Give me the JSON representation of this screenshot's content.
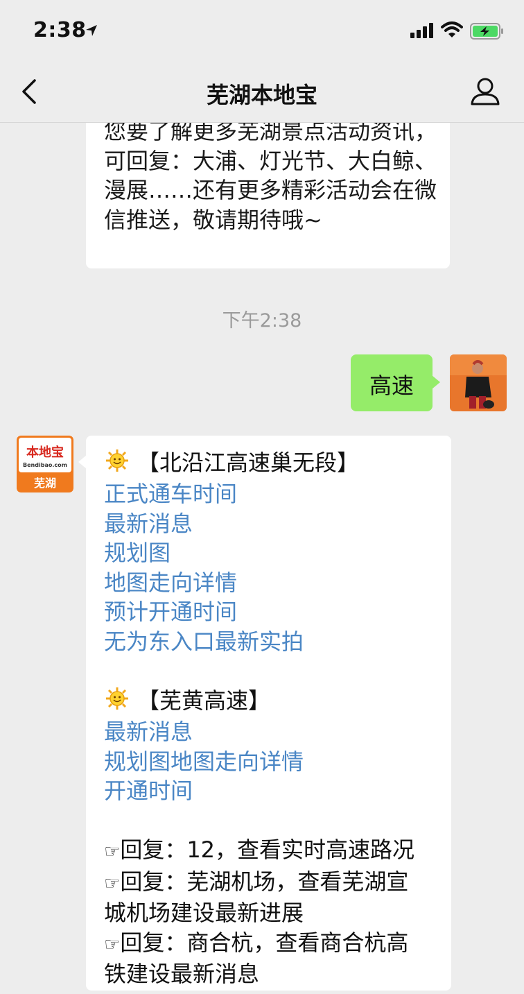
{
  "status_bar": {
    "time": "2:38"
  },
  "nav": {
    "title": "芜湖本地宝"
  },
  "top_message": {
    "text": "您要了解更多芜湖景点活动资讯，可回复：大浦、灯光节、大白鲸、漫展……还有更多精彩活动会在微信推送，敬请期待哦~"
  },
  "timestamp": "下午2:38",
  "user_message": {
    "text": "高速"
  },
  "bot_avatar": {
    "brand": "本地宝",
    "domain": "Bendibao.com",
    "city": "芜湖"
  },
  "bot_reply": {
    "section1": {
      "heading": "【北沿江高速巢无段】",
      "links": [
        "正式通车时间",
        "最新消息",
        "规划图",
        "地图走向详情",
        "预计开通时间",
        "无为东入口最新实拍"
      ]
    },
    "section2": {
      "heading": "【芜黄高速】",
      "links": [
        "最新消息",
        "规划图地图走向详情",
        "开通时间"
      ]
    },
    "tips": [
      {
        "hand": "☞",
        "lines": [
          "回复：12，查看实时高速路况"
        ]
      },
      {
        "hand": "☞",
        "lines": [
          "回复：芜湖机场，查看芜湖宣",
          "城机场建设最新进展"
        ]
      },
      {
        "hand": "☞",
        "lines": [
          "回复：商合杭，查看商合杭高",
          "铁建设最新消息"
        ]
      }
    ]
  },
  "colors": {
    "background": "#ededed",
    "link": "#4a86c5",
    "user_bubble": "#95ec69",
    "battery": "#4cd964"
  }
}
